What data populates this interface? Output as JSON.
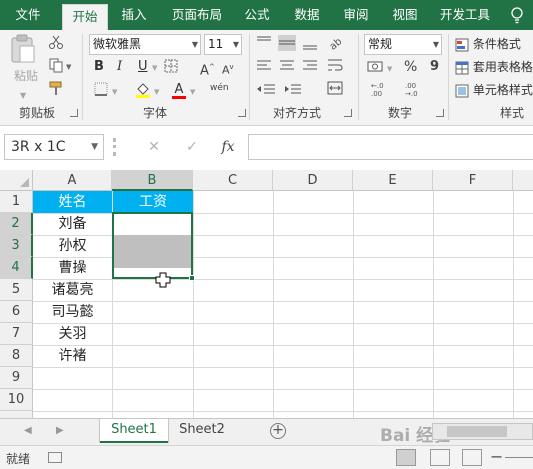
{
  "ribbon_tabs": [
    "文件",
    "开始",
    "插入",
    "页面布局",
    "公式",
    "数据",
    "审阅",
    "视图",
    "开发工具"
  ],
  "active_tab": "开始",
  "clipboard": {
    "paste_label": "粘贴",
    "group_label": "剪贴板"
  },
  "font": {
    "name": "微软雅黑",
    "size": "11",
    "bold": "B",
    "italic": "I",
    "underline": "U",
    "fill_char": "wén",
    "group_label": "字体"
  },
  "alignment": {
    "group_label": "对齐方式"
  },
  "number": {
    "format": "常规",
    "percent": "%",
    "comma": "9",
    "group_label": "数字"
  },
  "styles": {
    "conditional_format": "条件格式",
    "format_as_table": "套用表格格",
    "cell_styles": "单元格样式",
    "group_label": "样式"
  },
  "formula_bar": {
    "name_box": "3R x 1C",
    "cancel": "✕",
    "enter": "✓",
    "fx": "fx",
    "value": ""
  },
  "columns": [
    "A",
    "B",
    "C",
    "D",
    "E",
    "F"
  ],
  "selected_column": "B",
  "rows": [
    "1",
    "2",
    "3",
    "4",
    "5",
    "6",
    "7",
    "8",
    "9",
    "10"
  ],
  "selected_rows": [
    "2",
    "3",
    "4"
  ],
  "table": {
    "headers": [
      "姓名",
      "工资"
    ],
    "names": [
      "刘备",
      "孙权",
      "曹操",
      "诸葛亮",
      "司马懿",
      "关羽",
      "许褚"
    ]
  },
  "header_fill": "#00b0f0",
  "shade_fill": "#bfbfbf",
  "accent": "#217346",
  "sheets": [
    "Sheet1",
    "Sheet2"
  ],
  "active_sheet": "Sheet1",
  "add_sheet": "⊕",
  "watermark": "Bai 经验",
  "status": "就绪"
}
